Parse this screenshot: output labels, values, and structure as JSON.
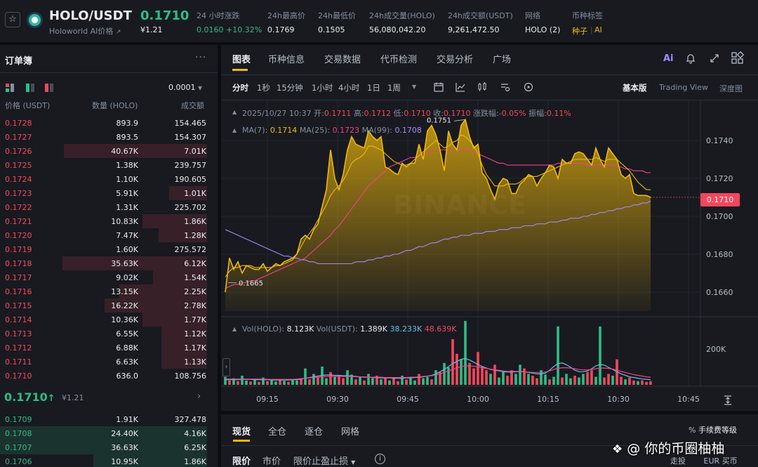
{
  "header": {
    "symbol": "HOLO/USDT",
    "token_name": "Holoworld AI价格",
    "price": "0.1710",
    "price_fiat": "¥1.21",
    "stats": [
      {
        "label": "24 小时涨跌",
        "value": "0.0160 +10.32%"
      },
      {
        "label": "24h最高价",
        "value": "0.1769"
      },
      {
        "label": "24h最低价",
        "value": "0.1505"
      },
      {
        "label": "24h成交量(HOLO)",
        "value": "56,080,042.20"
      },
      {
        "label": "24h成交额(USDT)",
        "value": "9,261,472.50"
      },
      {
        "label": "网络",
        "value": "HOLO (2)"
      }
    ],
    "tags_label": "币种标签",
    "tag_seed": "种子",
    "tag_ai": "AI"
  },
  "orderbook": {
    "title": "订单簿",
    "tick_size": "0.0001",
    "col_price": "价格 (USDT)",
    "col_qty": "数量 (HOLO)",
    "col_total": "成交额",
    "asks": [
      {
        "price": "0.1728",
        "qty": "893.9",
        "total": "154.465",
        "depth": 0.0
      },
      {
        "price": "0.1727",
        "qty": "893.5",
        "total": "154.307",
        "depth": 0.0
      },
      {
        "price": "0.1726",
        "qty": "40.67K",
        "total": "7.01K",
        "depth": 0.95
      },
      {
        "price": "0.1725",
        "qty": "1.38K",
        "total": "239.757",
        "depth": 0.0
      },
      {
        "price": "0.1724",
        "qty": "1.10K",
        "total": "190.605",
        "depth": 0.0
      },
      {
        "price": "0.1723",
        "qty": "5.91K",
        "total": "1.01K",
        "depth": 0.25
      },
      {
        "price": "0.1722",
        "qty": "1.31K",
        "total": "225.702",
        "depth": 0.0
      },
      {
        "price": "0.1721",
        "qty": "10.83K",
        "total": "1.86K",
        "depth": 0.43
      },
      {
        "price": "0.1720",
        "qty": "7.47K",
        "total": "1.28K",
        "depth": 0.32
      },
      {
        "price": "0.1719",
        "qty": "1.60K",
        "total": "275.572",
        "depth": 0.0
      },
      {
        "price": "0.1718",
        "qty": "35.63K",
        "total": "6.12K",
        "depth": 0.96
      },
      {
        "price": "0.1717",
        "qty": "9.02K",
        "total": "1.54K",
        "depth": 0.36
      },
      {
        "price": "0.1716",
        "qty": "13.15K",
        "total": "2.25K",
        "depth": 0.58
      },
      {
        "price": "0.1715",
        "qty": "16.22K",
        "total": "2.78K",
        "depth": 0.68
      },
      {
        "price": "0.1714",
        "qty": "10.36K",
        "total": "1.77K",
        "depth": 0.43
      },
      {
        "price": "0.1713",
        "qty": "6.55K",
        "total": "1.12K",
        "depth": 0.3
      },
      {
        "price": "0.1712",
        "qty": "6.88K",
        "total": "1.17K",
        "depth": 0.3
      },
      {
        "price": "0.1711",
        "qty": "6.63K",
        "total": "1.13K",
        "depth": 0.3
      },
      {
        "price": "0.1710",
        "qty": "636.0",
        "total": "108.756",
        "depth": 0.0
      }
    ],
    "last_price": "0.1710",
    "last_arrow": "↑",
    "last_fiat": "¥1.21",
    "bids": [
      {
        "price": "0.1709",
        "qty": "1.91K",
        "total": "327.478",
        "depth": 0.0
      },
      {
        "price": "0.1708",
        "qty": "24.40K",
        "total": "4.16K",
        "depth": 1.0
      },
      {
        "price": "0.1707",
        "qty": "36.63K",
        "total": "6.25K",
        "depth": 1.0
      },
      {
        "price": "0.1706",
        "qty": "10.95K",
        "total": "1.86K",
        "depth": 0.55
      }
    ]
  },
  "chart_tabs": [
    "图表",
    "币种信息",
    "交易数据",
    "代币检测",
    "交易分析",
    "广场"
  ],
  "tool_icons": [
    "ai-icon",
    "bell-icon",
    "expand-icon",
    "layout-icon"
  ],
  "intervals": [
    "分时",
    "1秒",
    "15分钟",
    "1小时",
    "4小时",
    "1日",
    "1周"
  ],
  "view_modes": [
    "基本版",
    "Trading View",
    "深度图"
  ],
  "ohlc_info": {
    "date": "2025/10/27 10:37",
    "open_label": "开:",
    "open": "0.1711",
    "high_label": "高:",
    "high": "0.1712",
    "low_label": "低:",
    "low": "0.1710",
    "close_label": "收:",
    "close": "0.1710",
    "change_label": "涨跌幅:",
    "change": "-0.05%",
    "amp_label": "振幅:",
    "amp": "0.11%"
  },
  "ma_info": {
    "ma7_label": "MA(7):",
    "ma7": "0.1714",
    "ma25_label": "MA(25):",
    "ma25": "0.1723",
    "ma99_label": "MA(99):",
    "ma99": "0.1708"
  },
  "vol_info": {
    "vol_holo_label": "Vol(HOLO):",
    "vol_holo": "8.123K",
    "vol_usdt_label": "Vol(USDT):",
    "vol_usdt": "1.389K",
    "ma_a": "38.233K",
    "ma_b": "48.639K"
  },
  "watermark": "BINANCE",
  "chart_data": {
    "type": "area",
    "x_ticks": [
      "09:15",
      "09:30",
      "09:45",
      "10:00",
      "10:15",
      "10:30",
      "10:45"
    ],
    "y_ticks": [
      0.174,
      0.172,
      0.17,
      0.168,
      0.166
    ],
    "ylim": [
      0.165,
      0.175
    ],
    "current_price": "0.1710",
    "annotations": {
      "high": "0.1751",
      "low": "0.1665"
    },
    "price": [
      0.166,
      0.1678,
      0.1672,
      0.1676,
      0.167,
      0.1674,
      0.1673,
      0.1672,
      0.1672,
      0.1675,
      0.1671,
      0.1673,
      0.1675,
      0.1674,
      0.1676,
      0.1677,
      0.1678,
      0.168,
      0.1688,
      0.169,
      0.1688,
      0.1693,
      0.1696,
      0.1705,
      0.1714,
      0.1735,
      0.172,
      0.1714,
      0.1722,
      0.1735,
      0.1742,
      0.1738,
      0.1737,
      0.1736,
      0.1745,
      0.1742,
      0.174,
      0.1742,
      0.1726,
      0.1725,
      0.1723,
      0.1722,
      0.1728,
      0.1726,
      0.1728,
      0.1728,
      0.1738,
      0.173,
      0.1745,
      0.1748,
      0.1743,
      0.1735,
      0.1724,
      0.1745,
      0.1738,
      0.1735,
      0.1748,
      0.1751,
      0.1742,
      0.1736,
      0.1738,
      0.1723,
      0.172,
      0.1714,
      0.1709,
      0.1717,
      0.172,
      0.1719,
      0.1712,
      0.1712,
      0.1717,
      0.1719,
      0.1722,
      0.1721,
      0.1716,
      0.172,
      0.1723,
      0.1727,
      0.1726,
      0.172,
      0.173,
      0.1728,
      0.1728,
      0.1733,
      0.1734,
      0.1733,
      0.173,
      0.1727,
      0.1736,
      0.173,
      0.1726,
      0.1736,
      0.1733,
      0.173,
      0.1722,
      0.172,
      0.1722,
      0.1712,
      0.1711,
      0.1711,
      0.1711,
      0.171
    ],
    "ma7": [
      0.1668,
      0.1671,
      0.1673,
      0.1673,
      0.1674,
      0.1674,
      0.1674,
      0.1673,
      0.1673,
      0.1673,
      0.1673,
      0.1673,
      0.1674,
      0.1674,
      0.1675,
      0.1676,
      0.1677,
      0.168,
      0.1684,
      0.1688,
      0.1691,
      0.1694,
      0.1698,
      0.1702,
      0.1706,
      0.1711,
      0.1714,
      0.1716,
      0.1719,
      0.1723,
      0.1728,
      0.173,
      0.1731,
      0.1733,
      0.1737,
      0.1737,
      0.1736,
      0.1735,
      0.1733,
      0.1731,
      0.1729,
      0.1728,
      0.1727,
      0.1727,
      0.1728,
      0.173,
      0.1732,
      0.1734,
      0.1736,
      0.1738,
      0.174,
      0.1738,
      0.1736,
      0.1737,
      0.1739,
      0.174,
      0.1743,
      0.1742,
      0.174,
      0.1737,
      0.1733,
      0.1727,
      0.1722,
      0.1719,
      0.1716,
      0.1716,
      0.1716,
      0.1717,
      0.1717,
      0.1717,
      0.1718,
      0.172,
      0.1721,
      0.1721,
      0.1721,
      0.1722,
      0.1723,
      0.1724,
      0.1725,
      0.1726,
      0.1727,
      0.1728,
      0.1729,
      0.173,
      0.173,
      0.173,
      0.173,
      0.173,
      0.1731,
      0.173,
      0.1729,
      0.173,
      0.173,
      0.173,
      0.1728,
      0.1726,
      0.1724,
      0.1721,
      0.1718,
      0.1716,
      0.1714,
      0.1714
    ],
    "ma25": [
      0.1662,
      0.1663,
      0.1664,
      0.1664,
      0.1665,
      0.1665,
      0.1666,
      0.1666,
      0.1667,
      0.1668,
      0.1669,
      0.167,
      0.1671,
      0.1672,
      0.1673,
      0.1674,
      0.1675,
      0.1676,
      0.1677,
      0.1678,
      0.168,
      0.1682,
      0.1684,
      0.1686,
      0.1688,
      0.169,
      0.1693,
      0.1695,
      0.1698,
      0.1701,
      0.1704,
      0.1707,
      0.171,
      0.1713,
      0.1716,
      0.1718,
      0.172,
      0.1722,
      0.1724,
      0.1726,
      0.1727,
      0.1728,
      0.1729,
      0.173,
      0.1731,
      0.1731,
      0.1732,
      0.1733,
      0.1734,
      0.1734,
      0.1735,
      0.1735,
      0.1735,
      0.1735,
      0.1735,
      0.1735,
      0.1735,
      0.1735,
      0.1735,
      0.1734,
      0.1733,
      0.1732,
      0.1731,
      0.173,
      0.1729,
      0.1728,
      0.1728,
      0.1727,
      0.1727,
      0.1727,
      0.1727,
      0.1727,
      0.1727,
      0.1727,
      0.1727,
      0.1727,
      0.1727,
      0.1727,
      0.1727,
      0.1728,
      0.1728,
      0.1728,
      0.1728,
      0.1728,
      0.1728,
      0.1728,
      0.1727,
      0.1727,
      0.1727,
      0.1727,
      0.1727,
      0.1727,
      0.1727,
      0.1726,
      0.1726,
      0.1725,
      0.1725,
      0.1724,
      0.1724,
      0.1724,
      0.1723,
      0.1723
    ],
    "ma99": [
      0.1693,
      0.1692,
      0.1691,
      0.169,
      0.1689,
      0.1688,
      0.1687,
      0.1686,
      0.1685,
      0.1684,
      0.1683,
      0.1682,
      0.1681,
      0.168,
      0.1679,
      0.1679,
      0.1678,
      0.1678,
      0.1677,
      0.1677,
      0.1676,
      0.1676,
      0.1675,
      0.1675,
      0.1675,
      0.1675,
      0.1675,
      0.1675,
      0.1675,
      0.1675,
      0.1675,
      0.1676,
      0.1676,
      0.1676,
      0.1677,
      0.1677,
      0.1678,
      0.1678,
      0.1679,
      0.1679,
      0.168,
      0.168,
      0.1681,
      0.1682,
      0.1682,
      0.1683,
      0.1684,
      0.1684,
      0.1685,
      0.1686,
      0.1686,
      0.1687,
      0.1688,
      0.1688,
      0.1689,
      0.1689,
      0.169,
      0.169,
      0.169,
      0.1691,
      0.1691,
      0.1691,
      0.1692,
      0.1692,
      0.1692,
      0.1693,
      0.1693,
      0.1693,
      0.1694,
      0.1694,
      0.1694,
      0.1695,
      0.1695,
      0.1695,
      0.1696,
      0.1696,
      0.1696,
      0.1697,
      0.1697,
      0.1697,
      0.1698,
      0.1698,
      0.1699,
      0.1699,
      0.1699,
      0.17,
      0.17,
      0.1701,
      0.1701,
      0.1702,
      0.1702,
      0.1703,
      0.1703,
      0.1704,
      0.1704,
      0.1705,
      0.1705,
      0.1706,
      0.1706,
      0.1707,
      0.1707,
      0.1708
    ],
    "volume_ticks": [
      "200K"
    ],
    "volume": [
      22,
      12,
      18,
      10,
      25,
      12,
      9,
      15,
      8,
      20,
      10,
      12,
      9,
      14,
      11,
      8,
      16,
      12,
      18,
      45,
      15,
      30,
      20,
      50,
      18,
      35,
      22,
      25,
      18,
      40,
      28,
      15,
      22,
      12,
      30,
      18,
      25,
      15,
      20,
      12,
      18,
      10,
      25,
      14,
      20,
      12,
      30,
      18,
      22,
      15,
      40,
      35,
      60,
      48,
      125,
      85,
      70,
      175,
      60,
      45,
      90,
      50,
      40,
      30,
      55,
      20,
      35,
      25,
      40,
      30,
      55,
      45,
      30,
      25,
      18,
      40,
      28,
      15,
      22,
      160,
      20,
      30,
      18,
      25,
      20,
      30,
      35,
      40,
      22,
      160,
      20,
      30,
      25,
      70,
      22,
      15,
      20,
      12,
      10,
      12,
      8,
      10
    ],
    "volume_up": [
      1,
      0,
      1,
      0,
      1,
      1,
      0,
      1,
      0,
      1,
      0,
      1,
      1,
      0,
      1,
      0,
      1,
      1,
      0,
      1,
      0,
      1,
      0,
      1,
      1,
      0,
      1,
      0,
      0,
      1,
      1,
      0,
      1,
      0,
      1,
      1,
      0,
      1,
      0,
      1,
      0,
      0,
      1,
      0,
      1,
      1,
      0,
      1,
      1,
      0,
      1,
      0,
      1,
      1,
      0,
      0,
      1,
      1,
      0,
      0,
      0,
      0,
      0,
      1,
      0,
      1,
      1,
      0,
      0,
      1,
      1,
      0,
      1,
      0,
      0,
      1,
      1,
      0,
      1,
      1,
      0,
      1,
      1,
      0,
      1,
      1,
      0,
      0,
      1,
      1,
      0,
      0,
      1,
      0,
      0,
      1,
      0,
      0,
      1,
      0,
      0,
      0
    ],
    "volume_ma_a": [
      14,
      14,
      14,
      14,
      15,
      15,
      15,
      14,
      14,
      14,
      14,
      13,
      13,
      13,
      13,
      13,
      14,
      14,
      16,
      18,
      20,
      22,
      24,
      26,
      27,
      27,
      26,
      26,
      25,
      25,
      24,
      23,
      22,
      21,
      21,
      20,
      20,
      19,
      19,
      19,
      18,
      18,
      18,
      19,
      19,
      20,
      21,
      22,
      24,
      26,
      30,
      36,
      42,
      50,
      58,
      64,
      70,
      72,
      68,
      62,
      56,
      50,
      46,
      42,
      40,
      38,
      36,
      35,
      35,
      36,
      36,
      36,
      34,
      32,
      30,
      30,
      32,
      40,
      50,
      58,
      60,
      55,
      48,
      40,
      36,
      36,
      38,
      44,
      52,
      56,
      54,
      48,
      42,
      36,
      30,
      26,
      22,
      20,
      18,
      16,
      15,
      14
    ],
    "volume_ma_b": [
      16,
      16,
      16,
      16,
      16,
      16,
      16,
      16,
      16,
      16,
      15,
      15,
      15,
      15,
      15,
      15,
      15,
      16,
      17,
      18,
      19,
      20,
      21,
      22,
      23,
      23,
      23,
      23,
      23,
      23,
      23,
      22,
      22,
      22,
      21,
      21,
      21,
      21,
      20,
      20,
      20,
      20,
      20,
      20,
      21,
      21,
      22,
      23,
      24,
      25,
      27,
      30,
      34,
      38,
      42,
      46,
      50,
      52,
      52,
      51,
      49,
      47,
      45,
      43,
      41,
      40,
      38,
      37,
      37,
      37,
      37,
      36,
      35,
      34,
      34,
      34,
      35,
      38,
      42,
      45,
      47,
      47,
      46,
      44,
      42,
      41,
      41,
      42,
      44,
      46,
      46,
      45,
      43,
      40,
      37,
      34,
      31,
      28,
      26,
      24,
      22,
      21
    ]
  },
  "order_tabs": [
    "现货",
    "全仓",
    "逐仓",
    "网格"
  ],
  "fee_label": "手续费等级",
  "order_types": [
    "限价",
    "市价",
    "限价止盈止损"
  ],
  "footer_watermark": "@ 你的币圈柚柚",
  "footer_links": [
    "走投",
    "EUR 买币"
  ]
}
